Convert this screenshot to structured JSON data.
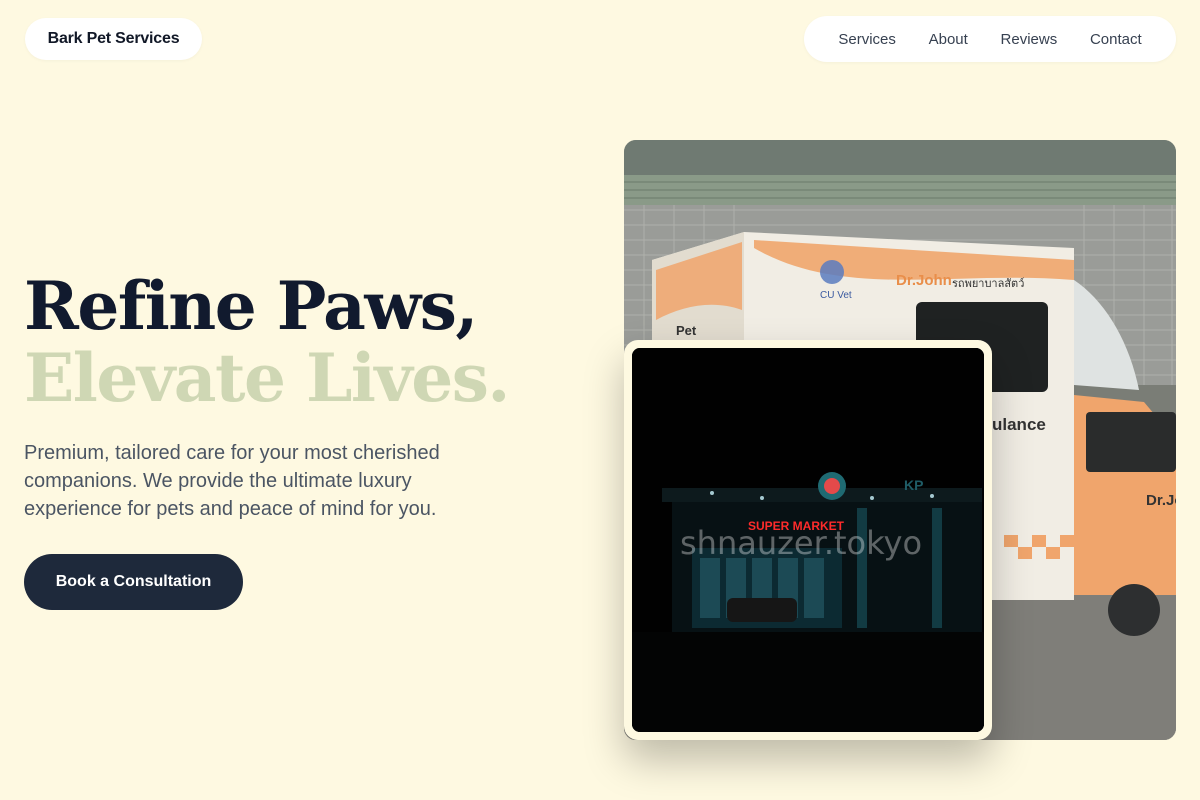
{
  "brand": {
    "name": "Bark Pet Services"
  },
  "nav": {
    "items": [
      {
        "label": "Services"
      },
      {
        "label": "About"
      },
      {
        "label": "Reviews"
      },
      {
        "label": "Contact"
      }
    ]
  },
  "hero": {
    "title_line1": "Refine Paws,",
    "title_line2": "Elevate Lives.",
    "subtitle": "Premium, tailored care for your most cherished companions. We provide the ultimate luxury experience for pets and peace of mind for you.",
    "cta_label": "Book a Consultation"
  },
  "images": {
    "main": {
      "van_brand": "Dr.John",
      "van_thai_text": "รถพยาบาลสัตว์",
      "van_side_text": "ulance",
      "van_logo_text": "CU Vet",
      "van_door_text": "Dr.Jo",
      "van_pet_text": "Pet"
    },
    "inset": {
      "store_sign": "SUPER MARKET",
      "store_letters": "KP",
      "watermark": "shnauzer.tokyo"
    }
  },
  "colors": {
    "background": "#fef9e1",
    "title_dark": "#111a2e",
    "title_light": "#cfd7b4",
    "cta_bg": "#1e293b",
    "van_orange": "#f0a56c"
  }
}
